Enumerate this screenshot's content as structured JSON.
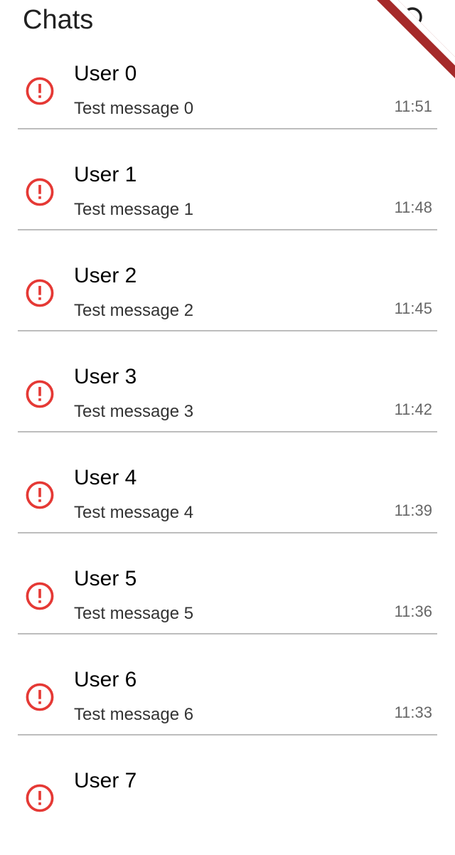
{
  "app_bar": {
    "title": "Chats",
    "search_icon": "search-icon"
  },
  "colors": {
    "error_icon": "#E53935",
    "debug_banner": "#A52A2A"
  },
  "chats": [
    {
      "name": "User 0",
      "message": "Test message 0",
      "time": "11:51",
      "status_icon": "error-icon"
    },
    {
      "name": "User 1",
      "message": "Test message 1",
      "time": "11:48",
      "status_icon": "error-icon"
    },
    {
      "name": "User 2",
      "message": "Test message 2",
      "time": "11:45",
      "status_icon": "error-icon"
    },
    {
      "name": "User 3",
      "message": "Test message 3",
      "time": "11:42",
      "status_icon": "error-icon"
    },
    {
      "name": "User 4",
      "message": "Test message 4",
      "time": "11:39",
      "status_icon": "error-icon"
    },
    {
      "name": "User 5",
      "message": "Test message 5",
      "time": "11:36",
      "status_icon": "error-icon"
    },
    {
      "name": "User 6",
      "message": "Test message 6",
      "time": "11:33",
      "status_icon": "error-icon"
    },
    {
      "name": "User 7",
      "message": "",
      "time": "",
      "status_icon": "error-icon"
    }
  ]
}
